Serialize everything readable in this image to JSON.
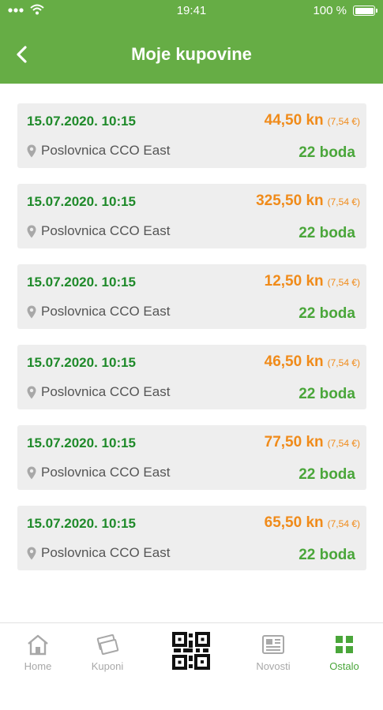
{
  "status_bar": {
    "time": "19:41",
    "battery": "100 %"
  },
  "header": {
    "title": "Moje kupovine"
  },
  "purchases": [
    {
      "date": "15.07.2020. 10:15",
      "amount": "44,50 kn",
      "amount_eur": "(7,54 €)",
      "location": "Poslovnica CCO East",
      "points": "22 boda"
    },
    {
      "date": "15.07.2020. 10:15",
      "amount": "325,50 kn",
      "amount_eur": "(7,54 €)",
      "location": "Poslovnica CCO East",
      "points": "22 boda"
    },
    {
      "date": "15.07.2020. 10:15",
      "amount": "12,50 kn",
      "amount_eur": "(7,54 €)",
      "location": "Poslovnica CCO East",
      "points": "22 boda"
    },
    {
      "date": "15.07.2020. 10:15",
      "amount": "46,50 kn",
      "amount_eur": "(7,54 €)",
      "location": "Poslovnica CCO East",
      "points": "22 boda"
    },
    {
      "date": "15.07.2020. 10:15",
      "amount": "77,50 kn",
      "amount_eur": "(7,54 €)",
      "location": "Poslovnica CCO East",
      "points": "22 boda"
    },
    {
      "date": "15.07.2020. 10:15",
      "amount": "65,50 kn",
      "amount_eur": "(7,54 €)",
      "location": "Poslovnica CCO East",
      "points": "22 boda"
    }
  ],
  "tabbar": {
    "items": [
      {
        "label": "Home",
        "icon": "home-icon"
      },
      {
        "label": "Kuponi",
        "icon": "coupon-icon"
      },
      {
        "label": "",
        "icon": "qr-code-icon"
      },
      {
        "label": "Novosti",
        "icon": "news-icon"
      },
      {
        "label": "Ostalo",
        "icon": "grid-icon",
        "active": true
      }
    ]
  },
  "colors": {
    "header": "#66ad45",
    "date": "#1f8a2a",
    "amount": "#f08b1a",
    "points": "#4aa63a",
    "active_tab": "#4aa63a"
  }
}
